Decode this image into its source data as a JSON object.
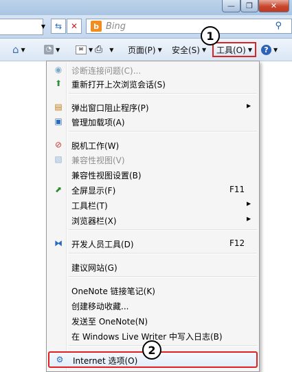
{
  "search": {
    "placeholder": "Bing"
  },
  "commandbar": {
    "page_label": "页面(P)",
    "safety_label": "安全(S)",
    "tools_label": "工具(O)"
  },
  "callouts": {
    "first": "1",
    "second": "2"
  },
  "menu": {
    "items": [
      {
        "label": "诊断连接问题(C)...",
        "icon": "diagnose-icon",
        "disabled": true
      },
      {
        "label": "重新打开上次浏览会话(S)",
        "icon": "reopen-session-icon"
      },
      {
        "label": "弹出窗口阻止程序(P)",
        "icon": "popup-blocker-icon",
        "submenu": true
      },
      {
        "label": "管理加载项(A)",
        "icon": "addons-icon"
      },
      {
        "label": "脱机工作(W)",
        "icon": "offline-icon"
      },
      {
        "label": "兼容性视图(V)",
        "icon": "compat-view-icon",
        "disabled": true
      },
      {
        "label": "兼容性视图设置(B)"
      },
      {
        "label": "全屏显示(F)",
        "icon": "fullscreen-icon",
        "shortcut": "F11"
      },
      {
        "label": "工具栏(T)",
        "submenu": true
      },
      {
        "label": "浏览器栏(X)",
        "submenu": true
      },
      {
        "label": "开发人员工具(D)",
        "icon": "dev-tools-icon",
        "shortcut": "F12"
      },
      {
        "label": "建议网站(G)"
      },
      {
        "label": "OneNote 链接笔记(K)"
      },
      {
        "label": "创建移动收藏..."
      },
      {
        "label": "发送至 OneNote(N)"
      },
      {
        "label": "在 Windows Live Writer 中写入日志(B)"
      },
      {
        "label": "Internet 选项(O)",
        "icon": "internet-options-icon"
      }
    ]
  }
}
